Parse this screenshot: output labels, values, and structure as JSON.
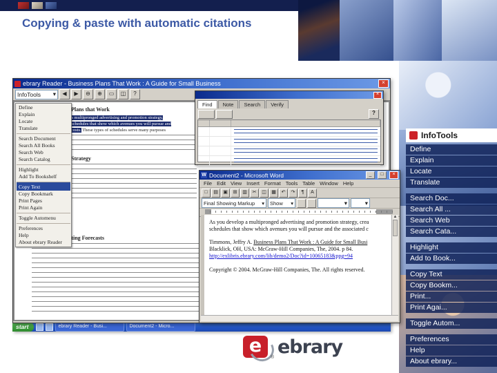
{
  "slide": {
    "title": "Copying & paste with automatic citations"
  },
  "infotools_panel": {
    "brand": "InfoTools",
    "items": [
      {
        "label": "Define",
        "cls": ""
      },
      {
        "label": "Explain",
        "cls": ""
      },
      {
        "label": "Locate",
        "cls": ""
      },
      {
        "label": "Translate",
        "cls": ""
      },
      {
        "label": "Search Doc...",
        "cls": "gap"
      },
      {
        "label": "Search All ...",
        "cls": ""
      },
      {
        "label": "Search Web",
        "cls": ""
      },
      {
        "label": "Search Cata...",
        "cls": ""
      },
      {
        "label": "Highlight",
        "cls": "gap"
      },
      {
        "label": "Add to Book...",
        "cls": ""
      },
      {
        "label": "Copy Text",
        "cls": "gap"
      },
      {
        "label": "Copy Bookm...",
        "cls": ""
      },
      {
        "label": "Print...",
        "cls": ""
      },
      {
        "label": "Print Agai...",
        "cls": ""
      },
      {
        "label": "Toggle Autom...",
        "cls": "gap"
      },
      {
        "label": "Preferences",
        "cls": "gap"
      },
      {
        "label": "Help",
        "cls": ""
      },
      {
        "label": "About ebrary...",
        "cls": ""
      }
    ]
  },
  "reader": {
    "window_title": "ebrary Reader - Business Plans That Work : A Guide for Small Business",
    "close_glyph": "×",
    "infotools_combo": "InfoTools",
    "combo_arrow": "▾",
    "toolbar_icons": [
      {
        "glyph": "◀",
        "cls": ""
      },
      {
        "glyph": "▶",
        "cls": ""
      },
      {
        "glyph": "⊖",
        "cls": ""
      },
      {
        "glyph": "⊕",
        "cls": ""
      },
      {
        "glyph": "▭",
        "cls": ""
      },
      {
        "glyph": "◫",
        "cls": ""
      },
      {
        "glyph": "?",
        "cls": ""
      }
    ],
    "menu_items": [
      {
        "label": "Define",
        "cls": ""
      },
      {
        "label": "Explain",
        "cls": ""
      },
      {
        "label": "Locate",
        "cls": ""
      },
      {
        "label": "Translate",
        "cls": ""
      },
      {
        "label": "Search Document",
        "cls": "sep"
      },
      {
        "label": "Search All Books",
        "cls": ""
      },
      {
        "label": "Search Web",
        "cls": ""
      },
      {
        "label": "Search Catalog",
        "cls": ""
      },
      {
        "label": "Highlight",
        "cls": "sep"
      },
      {
        "label": "Add To Bookshelf",
        "cls": ""
      },
      {
        "label": "Copy Text",
        "cls": "sep selected"
      },
      {
        "label": "Copy Bookmark",
        "cls": ""
      },
      {
        "label": "Print Pages",
        "cls": ""
      },
      {
        "label": "Print Again",
        "cls": ""
      },
      {
        "label": "Toggle Automenu",
        "cls": "sep"
      },
      {
        "label": "Preferences",
        "cls": "sep"
      },
      {
        "label": "Help",
        "cls": ""
      },
      {
        "label": "About ebrary Reader",
        "cls": ""
      }
    ],
    "page": {
      "heading": "Plans that Work",
      "selection_lines": [
        {
          "pre": "",
          "sel": "a multipronged advertising and promotion strategy,",
          "post": ""
        },
        {
          "pre": "",
          "sel": "schedules that show which avenues you will pursue and",
          "post": ""
        },
        {
          "pre": "",
          "sel": "costs.",
          "post": " These types of schedules serve many purposes"
        }
      ],
      "heading2": "Strategy",
      "heading3": "Sales and Marketing Forecasts"
    }
  },
  "popup": {
    "tabs": [
      {
        "label": "Find",
        "cls": "active"
      },
      {
        "label": "Note",
        "cls": ""
      },
      {
        "label": "Search",
        "cls": ""
      },
      {
        "label": "Verify",
        "cls": ""
      }
    ],
    "help_label": "?"
  },
  "word": {
    "window_title": "Document2 - Microsoft Word",
    "window_icon_letter": "W",
    "min_glyph": "_",
    "max_glyph": "□",
    "close_glyph": "×",
    "menus": [
      "File",
      "Edit",
      "View",
      "Insert",
      "Format",
      "Tools",
      "Table",
      "Window",
      "Help"
    ],
    "toolbar_icons": [
      {
        "glyph": "□",
        "cls": ""
      },
      {
        "glyph": "▤",
        "cls": ""
      },
      {
        "glyph": "▣",
        "cls": ""
      },
      {
        "glyph": "⊞",
        "cls": ""
      },
      {
        "glyph": "▥",
        "cls": ""
      },
      {
        "glyph": "✂",
        "cls": ""
      },
      {
        "glyph": "◫",
        "cls": ""
      },
      {
        "glyph": "▦",
        "cls": ""
      },
      {
        "glyph": "↶",
        "cls": ""
      },
      {
        "glyph": "↷",
        "cls": ""
      },
      {
        "glyph": "¶",
        "cls": ""
      },
      {
        "glyph": "A",
        "cls": ""
      }
    ],
    "review_combo": "Final Showing Markup",
    "show_combo": "Show",
    "combo_arrow": "▾",
    "doc": {
      "para_line1": "As you develop a multipronged advertising and promotion strategy, crea",
      "para_line2": "schedules that show which avenues you will pursue and the associated c",
      "cit_author": "Timmons, Jeffry A. ",
      "cit_title": "Business Plans That Work : A Guide for Small Busi",
      "cit_line2": "Blacklick, OH, USA: McGraw-Hill Companies, The, 2004. p 84.",
      "cit_url": "http://exlibris.ebrary.com/lib/demo2/Doc?id=10065183&ppg=94",
      "copyright": "Copyright © 2004. McGraw-Hill Companies, The. All rights reserved."
    }
  },
  "taskbar": {
    "start_label": "start",
    "tasks": [
      {
        "label": "ebrary Reader - Busi..."
      },
      {
        "label": "Document2 - Micro..."
      }
    ]
  },
  "logo": {
    "letter": "e",
    "wordmark": "ebrary",
    "reg": "®"
  }
}
